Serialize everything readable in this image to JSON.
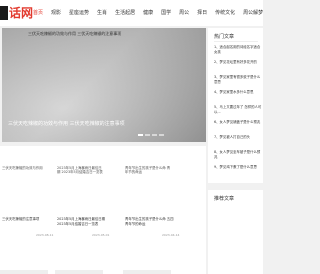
{
  "header": {
    "logo_text": "话网",
    "nav": [
      "首页",
      "观影",
      "星座运势",
      "生肖",
      "生活起居",
      "健康",
      "国学",
      "周公",
      "择日",
      "传统文化",
      "周公解梦"
    ]
  },
  "hero": {
    "image_title": "三伏天吃辣椒的功效与作用 三伏天吃辣椒的注意事项",
    "caption": "三伏天吃辣椒的功效与作用 三伏天吃辣椒的注意事项"
  },
  "sidebar": {
    "title": "热门文章",
    "items": [
      "1、适合起名用的诗经名字适合女孩",
      "2、梦见花坛里有好多花开的",
      "3、梦见家里有很多蚊子是什么意思",
      "4、梦见家里水多什么意思",
      "5、马上又要过年了 怎样的人可以...",
      "6、女人梦见铺盖子是什么预兆",
      "7、梦见被人打自己的头",
      "8、女人梦见坐车被子是什么预兆",
      "9、梦见鸡下蛋了是什么意思"
    ]
  },
  "sidebar2": {
    "title": "推荐文章"
  },
  "cards": [
    {
      "thumb_title": "三伏天吃辣椒的功效与作用",
      "title": "三伏天吃辣椒的注意事项",
      "date": "2023-08-11"
    },
    {
      "thumb_title": "2023年5月上海暴雨日最佳日期 2023年5月结婚吉日一览表",
      "title": "2023年5月上海暴雨日最佳日期 2023年5月结婚吉日一览表",
      "date": "2023-05-01"
    },
    {
      "thumb_title": "青年节出生的孩子是什么命 青年节的命运",
      "title": "青年节出生的孩子是什么命 五四青年节的命运",
      "date": "2023-04-14"
    }
  ]
}
